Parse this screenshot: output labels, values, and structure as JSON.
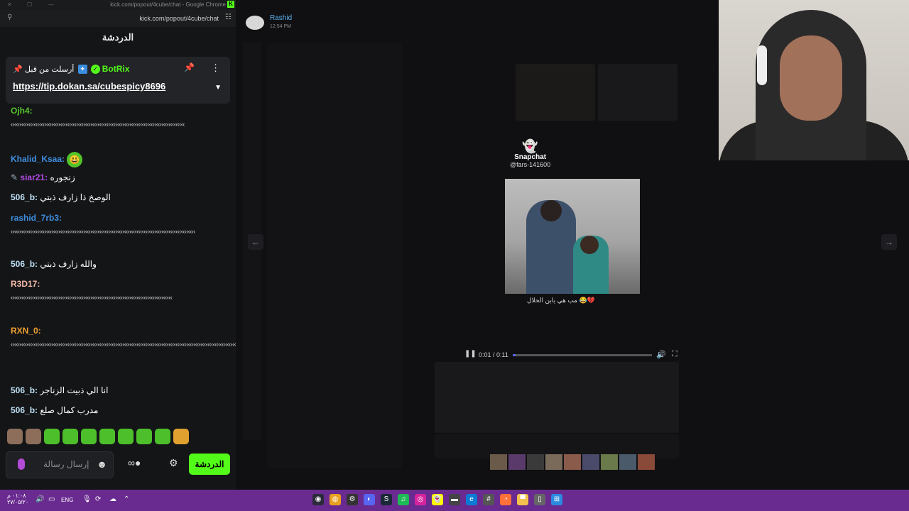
{
  "chat_window": {
    "title_url": "kick.com/popout/4cube/chat - Google Chrome",
    "address": "kick.com/popout/4cube/chat",
    "header": "الدردشة",
    "pinned": {
      "sender": "BotRix",
      "action": "أرسلت من قبل",
      "link": "https://tip.dokan.sa/cubespicy8696"
    },
    "messages": [
      {
        "user": "Ojh4:",
        "color": "#53c42a",
        "text": "",
        "spam": "‹‹‹‹‹‹‹‹‹‹‹‹‹‹‹‹‹‹‹‹‹‹‹‹‹‹‹‹‹‹‹‹‹‹‹‹‹‹‹‹‹‹‹‹‹‹‹‹‹‹‹‹‹‹‹‹‹‹‹‹‹‹‹‹‹‹‹‹‹‹‹‹‹‹‹‹‹‹‹‹‹‹‹‹‹‹‹‹‹‹‹‹‹‹‹‹‹‹"
      },
      {
        "user": "Khalid_Ksaa:",
        "color": "#3f8fe0",
        "text": "",
        "spam": ""
      },
      {
        "user": "siar21:",
        "color": "#b04be0",
        "text": "زنجوره",
        "spam": ""
      },
      {
        "user": "506_b:",
        "color": "#bde0f5",
        "text": "الوصخ ذا زارف ذبتي",
        "spam": ""
      },
      {
        "user": "rashid_7rb3:",
        "color": "#3f8fe0",
        "text": "",
        "spam": "‹‹‹‹‹‹‹‹‹‹‹‹‹‹‹‹‹‹‹‹‹‹‹‹‹‹‹‹‹‹‹‹‹‹‹‹‹‹‹‹‹‹‹‹‹‹‹‹‹‹‹‹‹‹‹‹‹‹‹‹‹‹‹‹‹‹‹‹‹‹‹‹‹‹‹‹‹‹‹‹‹‹‹‹‹‹‹‹‹‹‹‹‹‹‹‹‹‹‹‹‹‹‹‹"
      },
      {
        "user": "506_b:",
        "color": "#bde0f5",
        "text": "والله زارف ذبتي",
        "spam": ""
      },
      {
        "user": "R3D17:",
        "color": "#f2b9a8",
        "text": "",
        "spam": "‹‹‹‹‹‹‹‹‹‹‹‹‹‹‹‹‹‹‹‹‹‹‹‹‹‹‹‹‹‹‹‹‹‹‹‹‹‹‹‹‹‹‹‹‹‹‹‹‹‹‹‹‹‹‹‹‹‹‹‹‹‹‹‹‹‹‹‹‹‹‹‹‹‹‹‹‹‹‹‹‹‹‹‹‹‹‹‹‹‹‹"
      },
      {
        "user": "RXN_0:",
        "color": "#f0a030",
        "text": "",
        "spam": "‹‹‹‹‹‹‹‹‹‹‹‹‹‹‹‹‹‹‹‹‹‹‹‹‹‹‹‹‹‹‹‹‹‹‹‹‹‹‹‹‹‹‹‹‹‹‹‹‹‹‹‹‹‹‹‹‹‹‹‹‹‹‹‹‹‹‹‹‹‹‹‹‹‹‹‹‹‹‹‹‹‹‹‹‹‹‹‹‹‹‹‹‹‹‹‹‹‹‹‹‹‹‹‹‹‹‹‹‹‹‹‹‹‹‹‹‹‹‹‹‹‹‹‹‹‹‹‹‹‹‹‹‹‹‹‹‹‹‹‹‹‹"
      },
      {
        "user": "506_b:",
        "color": "#bde0f5",
        "text": "انا الي ذبيت الزناجر",
        "spam": ""
      },
      {
        "user": "506_b:",
        "color": "#bde0f5",
        "text": "مدرب كمال صلع",
        "spam": ""
      }
    ],
    "input_placeholder": "إرسال رسالة",
    "send_label": "الدردشة"
  },
  "discord": {
    "author": "Rashid",
    "timestamp": "12:54 PM",
    "snapchat_label": "Snapchat",
    "snapchat_user": "@fars-141600",
    "caption": "مب هي يابن الحلال 😂💔",
    "video_time": "0:01 / 0:11",
    "progress": 0.02
  },
  "taskbar": {
    "clock_line1": "٠١:٠٨ م",
    "clock_line2": "٢٧/٠٥/٢٠",
    "lang": "ENG"
  }
}
